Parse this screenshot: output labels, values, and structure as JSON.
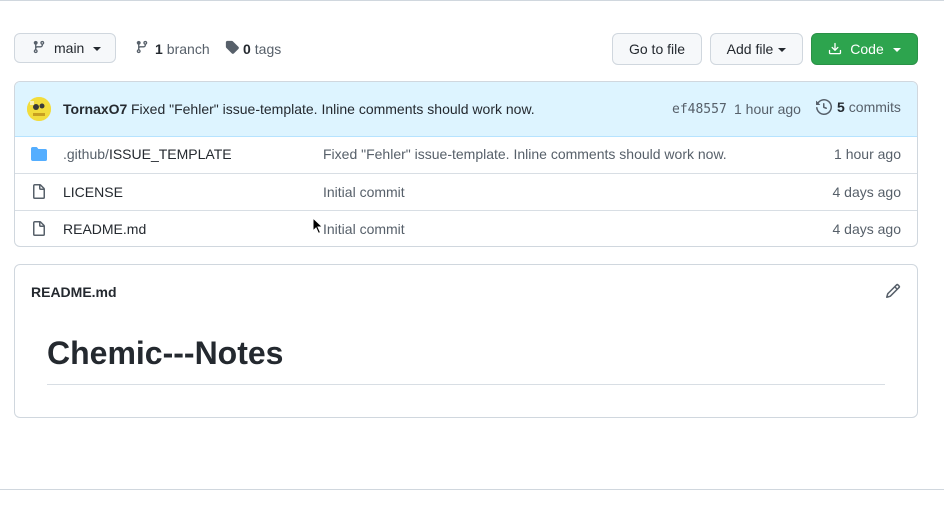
{
  "toolbar": {
    "branch_label": "main",
    "branch_count": "1",
    "branch_word": "branch",
    "tag_count": "0",
    "tag_word": "tags",
    "goto_file": "Go to file",
    "add_file": "Add file",
    "code": "Code"
  },
  "commit": {
    "author": "TornaxO7",
    "message": "Fixed \"Fehler\" issue-template. Inline comments should work now.",
    "sha": "ef48557",
    "time": "1 hour ago",
    "count": "5",
    "count_word": "commits"
  },
  "files": [
    {
      "prefix": ".github/",
      "name": "ISSUE_TEMPLATE",
      "type": "folder",
      "message": "Fixed \"Fehler\" issue-template. Inline comments should work now.",
      "age": "1 hour ago"
    },
    {
      "prefix": "",
      "name": "LICENSE",
      "type": "file",
      "message": "Initial commit",
      "age": "4 days ago"
    },
    {
      "prefix": "",
      "name": "README.md",
      "type": "file",
      "message": "Initial commit",
      "age": "4 days ago"
    }
  ],
  "readme": {
    "title": "README.md",
    "heading": "Chemic---Notes"
  },
  "colors": {
    "accent_green": "#2da44e",
    "commit_bar_bg": "#ddf4ff",
    "folder_blue": "#54aeff"
  },
  "icons": [
    "git-branch-icon",
    "tag-icon",
    "download-icon",
    "history-icon",
    "folder-icon",
    "file-icon",
    "pencil-icon"
  ]
}
